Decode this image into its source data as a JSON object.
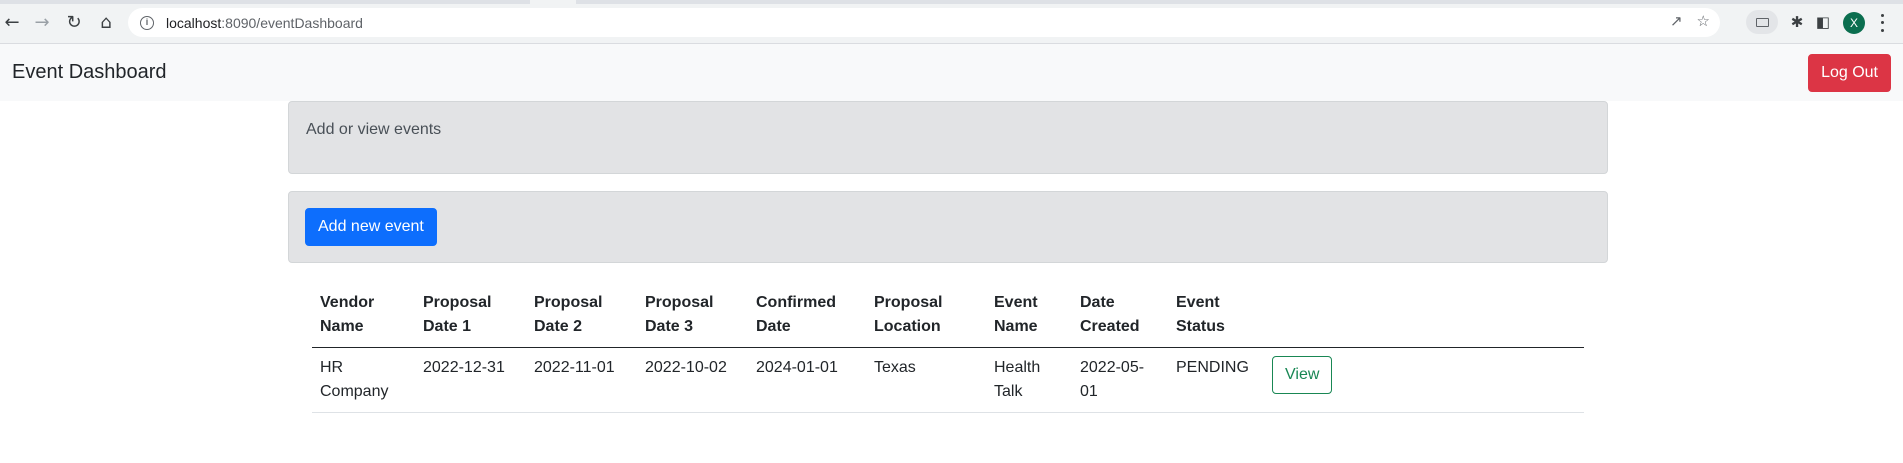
{
  "browser": {
    "url_host": "localhost",
    "url_rest": ":8090/eventDashboard",
    "profile_initial": "X"
  },
  "navbar": {
    "brand": "Event Dashboard",
    "logout_label": "Log Out"
  },
  "info_panel": {
    "text": "Add or view events"
  },
  "actions": {
    "add_label": "Add new event"
  },
  "table": {
    "headers": [
      "Vendor Name",
      "Proposal Date 1",
      "Proposal Date 2",
      "Proposal Date 3",
      "Confirmed Date",
      "Proposal Location",
      "Event Name",
      "Date Created",
      "Event Status",
      ""
    ],
    "rows": [
      {
        "vendor": "HR Company",
        "date1": "2022-12-31",
        "date2": "2022-11-01",
        "date3": "2022-10-02",
        "confirmed": "2024-01-01",
        "location": "Texas",
        "event_name": "Health Talk",
        "created": "2022-05-01",
        "status": "PENDING",
        "action_label": "View"
      }
    ]
  },
  "colors": {
    "danger": "#dc3545",
    "primary": "#0d6efd",
    "success": "#198754"
  }
}
